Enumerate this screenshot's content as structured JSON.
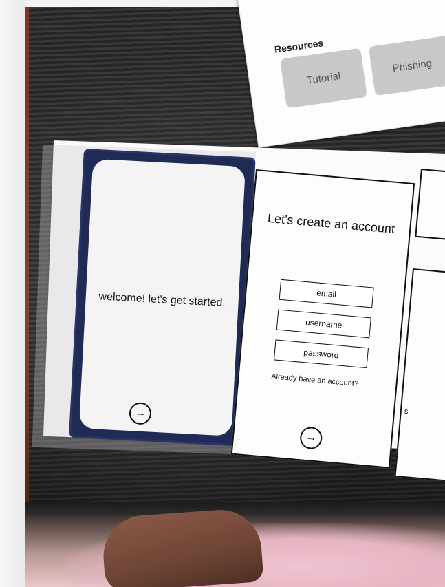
{
  "resources_card": {
    "heading": "Resources",
    "buttons": [
      "Tutorial",
      "Phishing"
    ]
  },
  "welcome_screen": {
    "message": "welcome! let's get started.",
    "next_icon": "arrow-right-circle-icon"
  },
  "signup_screen": {
    "title": "Let's create an account",
    "fields": {
      "email": "email",
      "username": "username",
      "password": "password"
    },
    "login_link": "Already have an account?",
    "next_icon": "arrow-right-circle-icon"
  },
  "partial_screen": {
    "letters": [
      "s"
    ]
  }
}
